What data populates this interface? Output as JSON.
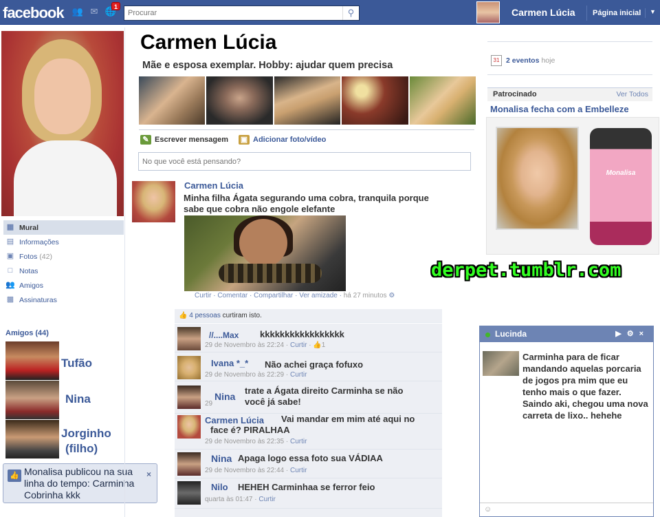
{
  "topbar": {
    "logo": "facebook",
    "notif_count": "1",
    "search_placeholder": "Procurar",
    "user_name": "Carmen Lúcia",
    "home_label": "Página inicial"
  },
  "left": {
    "nav": [
      {
        "label": "Mural",
        "icon": "wall-icon"
      },
      {
        "label": "Informações",
        "icon": "info-icon"
      },
      {
        "label": "Fotos",
        "count": "(42)",
        "icon": "photos-icon"
      },
      {
        "label": "Notas",
        "icon": "notes-icon"
      },
      {
        "label": "Amigos",
        "icon": "friends-icon"
      },
      {
        "label": "Assinaturas",
        "icon": "subscriptions-icon"
      }
    ],
    "friends_header": "Amigos (44)",
    "friends": [
      "Tufão",
      "Nina",
      "Jorginho",
      "(filho)"
    ],
    "toast": "Monalisa publicou na sua linha do tempo: Carminha Cobrinha kkk"
  },
  "profile": {
    "name": "Carmen Lúcia",
    "bio": "Mãe e esposa exemplar. Hobby: ajudar quem precisa",
    "write_message": "Escrever mensagem",
    "add_photo": "Adicionar foto/vídeo",
    "composer_placeholder": "No que você está pensando?"
  },
  "post": {
    "author": "Carmen Lúcia",
    "text": "Minha filha Ágata segurando uma cobra, tranquila porque sabe que cobra não engole elefante",
    "meta_actions": "Curtir · Comentar · Compartilhar · Ver amizade ·",
    "meta_time": "há 27 minutos",
    "likes": "4 pessoas",
    "likes_suffix": "curtiram isto."
  },
  "comments": [
    {
      "name": "//....Max",
      "text": "kkkkkkkkkkkkkkkkk",
      "date": "29 de Novembro às 22:24",
      "like": "Curtir",
      "likes": "1"
    },
    {
      "name": "Ivana *_*",
      "text": "Não achei graça fofuxo",
      "date": "29 de Novembro às 22:29",
      "like": "Curtir"
    },
    {
      "name": "Nina",
      "text": "trate a Ágata direito Carminha se não você já sabe!",
      "date": "29",
      "like": ""
    },
    {
      "name": "Carmen Lúcia",
      "text": "Vai mandar em mim até aqui no face é? PIRALHAA",
      "date": "29 de Novembro às 22:35",
      "like": "Curtir"
    },
    {
      "name": "Nina",
      "text": "Apaga logo essa foto sua VÁDIAA",
      "date": "29 de Novembro às 22:44",
      "like": "Curtir"
    },
    {
      "name": "Nilo",
      "text": "HEHEH Carminhaa se ferror feio",
      "date": "quarta às 01:47",
      "like": "Curtir"
    }
  ],
  "right": {
    "events_count": "2 eventos",
    "events_when": "hoje",
    "sponsored": "Patrocinado",
    "see_all": "Ver Todos",
    "ad_title": "Monalisa fecha com a Embelleze",
    "ad_brand": "Monalisa",
    "watermark": "derpet.tumblr.com"
  },
  "chat": {
    "name": "Lucinda",
    "message": "Carminha para de ficar mandando aquelas porcaria de jogos pra mim que eu tenho mais o que fazer. Saindo aki, chegou uma nova carreta de lixo.. hehehe"
  }
}
